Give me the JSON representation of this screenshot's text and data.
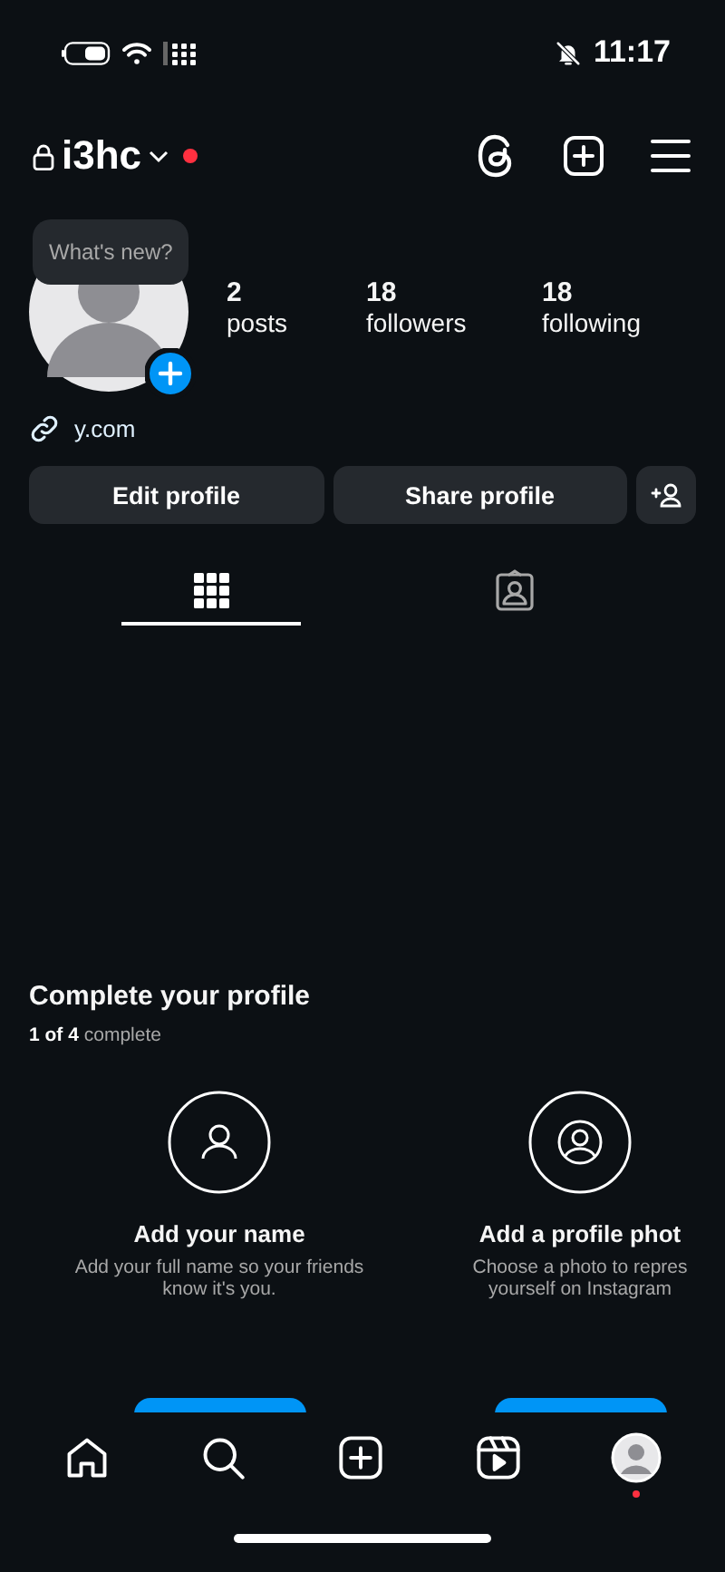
{
  "status_bar": {
    "time": "11:17"
  },
  "header": {
    "username": "i3hc",
    "private": true,
    "notification": true
  },
  "profile": {
    "tooltip": "What's new?",
    "stats": [
      {
        "value": "2",
        "label": "posts"
      },
      {
        "value": "18",
        "label": "followers"
      },
      {
        "value": "18",
        "label": "following"
      }
    ],
    "link": "y.com",
    "buttons": [
      "Edit profile",
      "Share profile"
    ]
  },
  "tabs": [
    {
      "kind": "grid",
      "selected": true
    },
    {
      "kind": "tagged",
      "selected": false
    }
  ],
  "complete_profile": {
    "title": "Complete your profile",
    "progress": "**1 of 4** complete",
    "cards": [
      {
        "kind": "name",
        "title": "Add your name",
        "description": "Add your full name so your friends\nknow it's you."
      },
      {
        "kind": "photo",
        "title": "Add a profile phot",
        "description": "Choose a photo to repres\nyourself on Instagram"
      }
    ]
  },
  "bottom_nav": [
    {
      "kind": "home",
      "selected": false
    },
    {
      "kind": "search",
      "selected": false
    },
    {
      "kind": "create",
      "selected": false
    },
    {
      "kind": "reels",
      "selected": false
    },
    {
      "kind": "profile",
      "selected": true,
      "notification": true
    }
  ]
}
